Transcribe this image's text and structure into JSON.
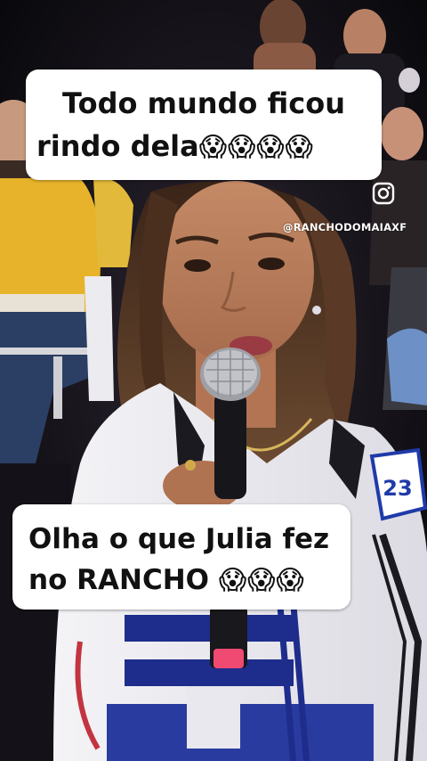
{
  "captions": {
    "top_line1": "Todo mundo ficou",
    "top_line2": "rindo dela",
    "top_emojis": "😱😱😱😱",
    "bottom_line1": "Olha o que Julia fez",
    "bottom_line2": "no RANCHO",
    "bottom_emojis": "😱😱😱"
  },
  "watermark": {
    "icon": "instagram-icon",
    "handle": "@RANCHODOMAIAXF"
  },
  "jacket_number": "23"
}
